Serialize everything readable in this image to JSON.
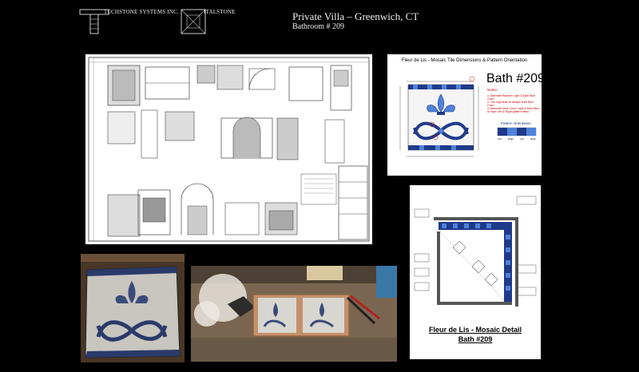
{
  "header": {
    "logo_left": "TECHSTONE SYSTEMS INC.",
    "logo_right": "ITALSTONE",
    "title": "Private Villa – Greenwich, CT",
    "subtitle": "Bathroom # 209"
  },
  "tile_sheet": {
    "title": "Fleur de Lis - Mosaic Tile Dimensions & Pattern Orientation",
    "big_label": "Bath #209",
    "notes_header": "Notes:",
    "notes": [
      "1. Alternate Random Light & Dark Blue Color",
      "2. The ring must be always Dark Blue Color",
      "3. Alternate Arms Color: Light & Dark Blue to have Left & Right pattern effect"
    ],
    "pattern_label": "Pattern Orientation",
    "pattern_captions": [
      "Left",
      "Right",
      "Left",
      "Right"
    ]
  },
  "detail_sheet": {
    "caption_line1": "Fleur de Lis - Mosaic Detail",
    "caption_line2": "Bath #209"
  },
  "colors": {
    "background": "#000000",
    "mosaic_dark_blue": "#1f3a8a",
    "mosaic_light_blue": "#4f82d9"
  }
}
